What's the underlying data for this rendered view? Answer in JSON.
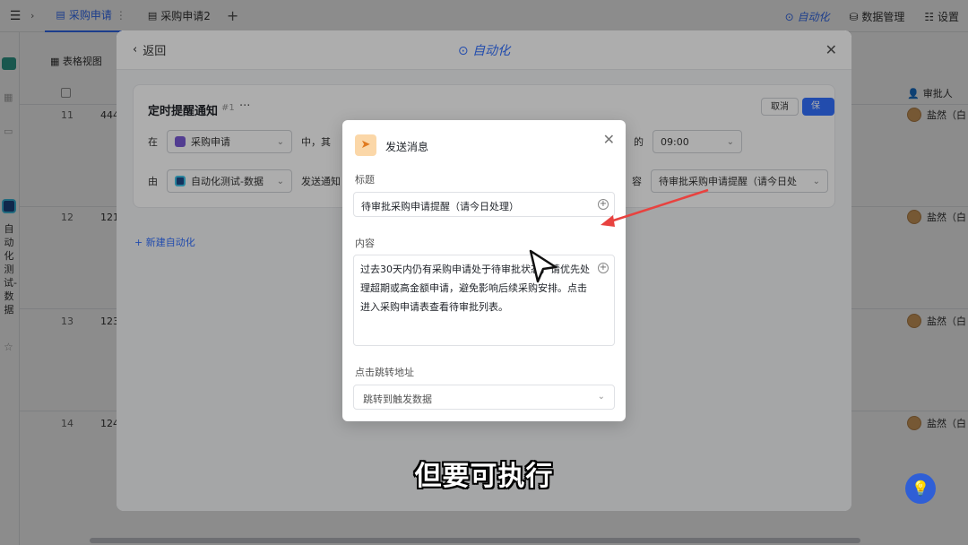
{
  "topbar": {
    "tabs": [
      {
        "label": "采购申请",
        "active": true,
        "suffix": "⋮"
      },
      {
        "label": "采购申请2",
        "active": false
      }
    ],
    "right": {
      "automation": "自动化",
      "data_manage": "数据管理",
      "settings": "设置"
    }
  },
  "sidebar": {
    "app_name_vertical": "自动化测试-数据"
  },
  "table": {
    "view_label": "表格视图",
    "approver_header": "审批人",
    "rows": [
      {
        "num": "11",
        "id": "444",
        "approver": "盐然（白"
      },
      {
        "num": "12",
        "id": "121",
        "approver": "盐然（白"
      },
      {
        "num": "13",
        "id": "123",
        "approver": "盐然（白"
      },
      {
        "num": "14",
        "id": "124",
        "approver": "盐然（白"
      }
    ]
  },
  "panel": {
    "back_label": "返回",
    "title": "自动化",
    "rule": {
      "name": "定时提醒通知",
      "tag": "#1",
      "cancel_label": "取消",
      "save_label": "保存",
      "row1": {
        "prefix": "在",
        "table": "采购申请",
        "mid": "中，其",
        "time_prefix": "的",
        "time": "09:00"
      },
      "row2": {
        "prefix": "由",
        "source": "自动化测试-数据",
        "action": "发送通知",
        "content_prefix": "容",
        "content_value": "待审批采购申请提醒（请今日处"
      }
    },
    "new_automation": "新建自动化"
  },
  "dialog": {
    "title": "发送消息",
    "title_label": "标题",
    "title_value": "待审批采购申请提醒（请今日处理）",
    "content_label": "内容",
    "content_value": "过去30天内仍有采购申请处于待审批状态，请优先处理超期或高金额申请，避免影响后续采购安排。点击进入采购申请表查看待审批列表。",
    "jump_label": "点击跳转地址",
    "jump_value": "跳转到触发数据"
  },
  "caption": "但要可执行",
  "colors": {
    "accent": "#3370ff",
    "annotation_arrow": "#e8423f"
  }
}
